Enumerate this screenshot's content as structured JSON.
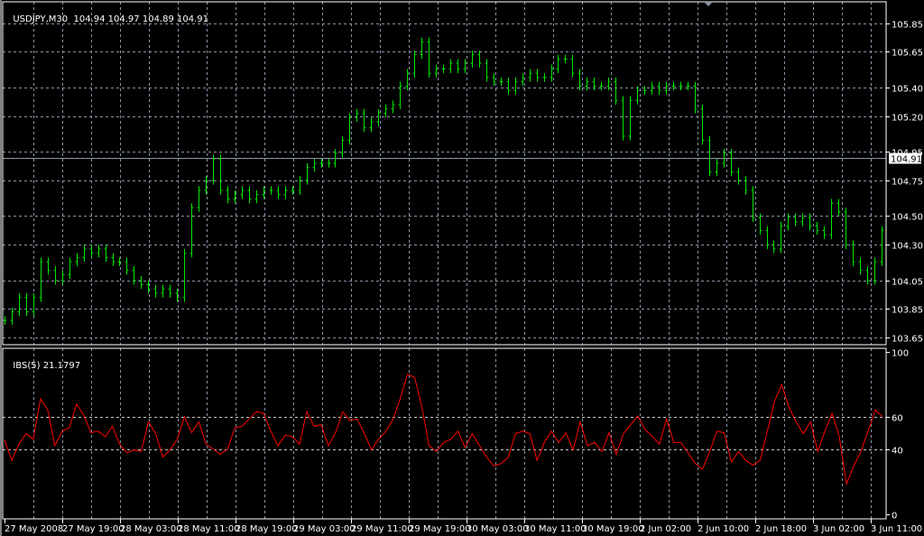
{
  "header": {
    "symbol": "USDJPY,M30",
    "ohlc": "104.94 104.97 104.89 104.91"
  },
  "indicator_header": {
    "name": "IBS(5)",
    "value": "21.1797"
  },
  "colors": {
    "background": "#000000",
    "bars": "#00e600",
    "indicator_line": "#ff0000",
    "grid": "#8a93a6",
    "panel_border": "#ffffff",
    "bid_line": "#8a93a6"
  },
  "chart_data": [
    {
      "type": "bar",
      "title": "USDJPY,M30",
      "style": "ohlc",
      "current_price": 104.91,
      "current_price_label": "104.91",
      "ylim": [
        103.6,
        106.0
      ],
      "grid": true,
      "y_ticks": [
        105.85,
        105.65,
        105.4,
        105.2,
        104.95,
        104.75,
        104.5,
        104.3,
        104.05,
        103.85,
        103.65
      ],
      "y_tick_labels": [
        "105.85",
        "105.65",
        "105.40",
        "105.20",
        "104.95",
        "104.75",
        "104.50",
        "104.30",
        "104.05",
        "103.85",
        "103.65"
      ],
      "x_tick_labels": [
        "27 May 2008",
        "27 May 19:00",
        "28 May 03:00",
        "28 May 11:00",
        "28 May 19:00",
        "29 May 03:00",
        "29 May 11:00",
        "29 May 19:00",
        "30 May 03:00",
        "30 May 11:00",
        "30 May 19:00",
        "2 Jun 02:00",
        "2 Jun 10:00",
        "2 Jun 18:00",
        "3 Jun 02:00",
        "3 Jun 11:00"
      ],
      "closes": [
        103.77,
        103.83,
        103.93,
        103.83,
        103.93,
        104.18,
        104.12,
        104.05,
        104.09,
        104.18,
        104.21,
        104.27,
        104.24,
        104.27,
        104.21,
        104.18,
        104.18,
        104.12,
        104.05,
        104.02,
        103.99,
        103.96,
        103.99,
        103.96,
        103.93,
        104.24,
        104.56,
        104.68,
        104.75,
        104.9,
        104.68,
        104.62,
        104.65,
        104.68,
        104.62,
        104.65,
        104.68,
        104.68,
        104.65,
        104.68,
        104.68,
        104.75,
        104.84,
        104.87,
        104.87,
        104.87,
        104.94,
        105.03,
        105.19,
        105.22,
        105.12,
        105.16,
        105.22,
        105.25,
        105.28,
        105.41,
        105.5,
        105.63,
        105.72,
        105.5,
        105.53,
        105.53,
        105.57,
        105.53,
        105.57,
        105.63,
        105.57,
        105.47,
        105.44,
        105.44,
        105.38,
        105.44,
        105.47,
        105.5,
        105.47,
        105.47,
        105.53,
        105.6,
        105.6,
        105.5,
        105.41,
        105.44,
        105.41,
        105.41,
        105.44,
        105.31,
        105.06,
        105.31,
        105.38,
        105.38,
        105.41,
        105.38,
        105.41,
        105.41,
        105.41,
        105.41,
        105.25,
        105.03,
        104.81,
        104.87,
        104.94,
        104.81,
        104.75,
        104.68,
        104.49,
        104.4,
        104.3,
        104.27,
        104.43,
        104.49,
        104.46,
        104.49,
        104.43,
        104.4,
        104.37,
        104.59,
        104.53,
        104.3,
        104.18,
        104.12,
        104.05,
        104.18,
        104.4
      ]
    },
    {
      "type": "line",
      "title": "IBS(5)",
      "last_value": 21.1797,
      "ylim": [
        -3,
        102
      ],
      "grid": true,
      "y_ticks": [
        100,
        60,
        40,
        0
      ],
      "y_tick_labels": [
        "100",
        "60",
        "40",
        "0"
      ],
      "values": [
        45.8,
        33,
        43,
        49.5,
        46,
        71,
        64,
        42,
        51,
        53,
        67.6,
        61,
        50,
        51,
        47.6,
        54,
        43,
        37.6,
        39.5,
        38.5,
        56.7,
        49.5,
        35,
        39.5,
        46,
        60,
        50,
        56.7,
        43,
        40,
        36.7,
        40,
        53,
        54,
        58.5,
        63,
        62,
        51,
        42,
        48.5,
        47.6,
        43,
        63,
        54,
        55,
        42,
        50,
        63,
        57.6,
        58.5,
        49.5,
        39.5,
        46,
        51,
        58.5,
        71,
        86,
        84,
        65.8,
        42,
        38.5,
        44,
        46,
        51,
        41,
        49.5,
        42,
        35,
        29.5,
        31,
        35,
        49.5,
        51,
        49.5,
        33,
        44,
        51,
        44,
        50,
        39.5,
        56.7,
        42,
        44,
        38.5,
        50,
        36.7,
        49.5,
        55,
        60.4,
        52,
        47.6,
        43,
        58.5,
        44,
        44,
        37.6,
        31,
        27.6,
        38.5,
        51,
        50,
        32,
        38.5,
        33,
        30,
        33,
        51,
        69.5,
        79.6,
        65.8,
        56.7,
        49.5,
        56.7,
        38.5,
        51,
        62,
        47.6,
        18.5,
        29.5,
        38.5,
        51,
        64,
        60
      ]
    }
  ]
}
